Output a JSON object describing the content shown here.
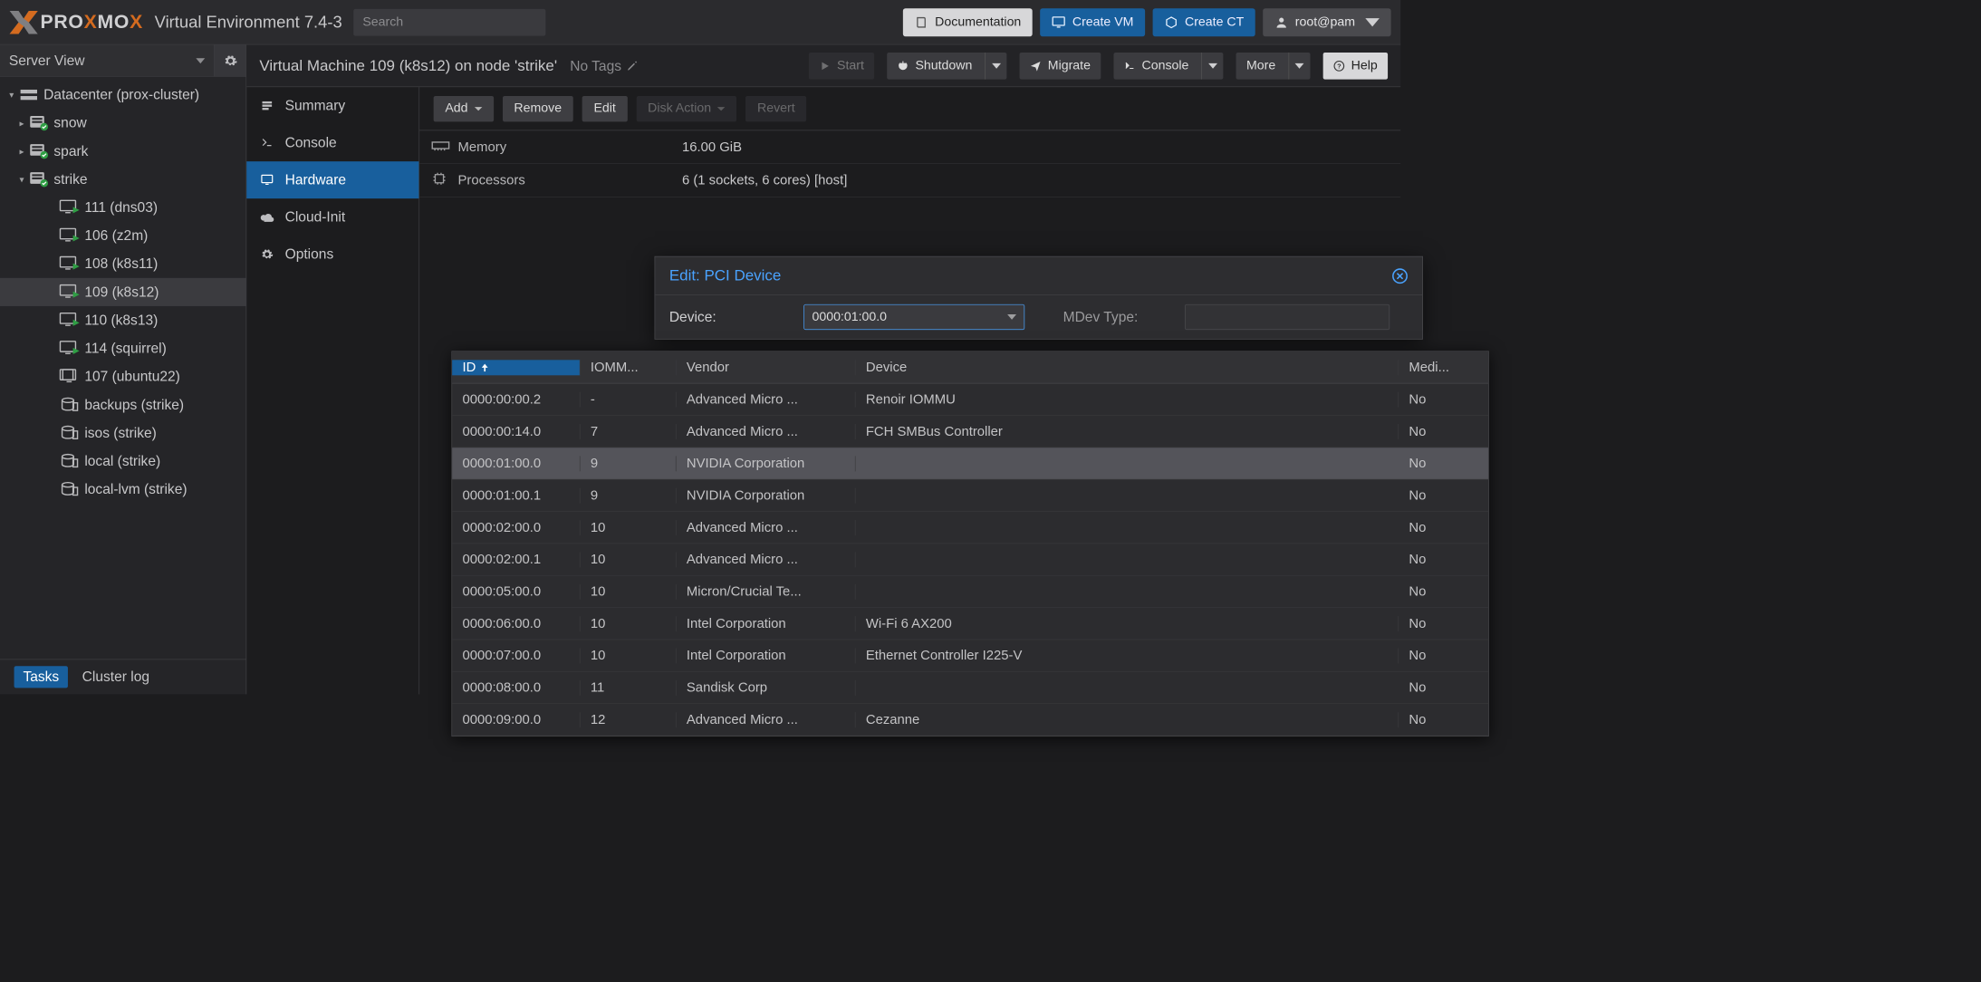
{
  "header": {
    "product": "PROXMOX",
    "env": "Virtual Environment 7.4-3",
    "search_placeholder": "Search",
    "doc": "Documentation",
    "create_vm": "Create VM",
    "create_ct": "Create CT",
    "user": "root@pam"
  },
  "view_selector": "Server View",
  "tree": {
    "dc": "Datacenter (prox-cluster)",
    "nodes": [
      "snow",
      "spark",
      "strike"
    ],
    "strike_items": [
      {
        "icon": "vm",
        "label": "111 (dns03)"
      },
      {
        "icon": "vm",
        "label": "106 (z2m)"
      },
      {
        "icon": "vm",
        "label": "108 (k8s11)"
      },
      {
        "icon": "vm",
        "label": "109 (k8s12)",
        "sel": true
      },
      {
        "icon": "vm",
        "label": "110 (k8s13)"
      },
      {
        "icon": "vm",
        "label": "114 (squirrel)"
      },
      {
        "icon": "ct",
        "label": "107 (ubuntu22)"
      },
      {
        "icon": "st",
        "label": "backups (strike)"
      },
      {
        "icon": "st",
        "label": "isos (strike)"
      },
      {
        "icon": "st",
        "label": "local (strike)"
      },
      {
        "icon": "st",
        "label": "local-lvm (strike)"
      }
    ]
  },
  "footer": {
    "tasks": "Tasks",
    "cluster": "Cluster log"
  },
  "vm": {
    "title": "Virtual Machine 109 (k8s12) on node 'strike'",
    "notags": "No Tags",
    "btn": {
      "start": "Start",
      "shutdown": "Shutdown",
      "migrate": "Migrate",
      "console": "Console",
      "more": "More",
      "help": "Help"
    }
  },
  "side": [
    "Summary",
    "Console",
    "Hardware",
    "Cloud-Init",
    "Options"
  ],
  "toolbar": {
    "add": "Add",
    "remove": "Remove",
    "edit": "Edit",
    "disk": "Disk Action",
    "revert": "Revert"
  },
  "hw": {
    "memory": {
      "name": "Memory",
      "value": "16.00 GiB"
    },
    "cpu": {
      "name": "Processors",
      "value": "6 (1 sockets, 6 cores) [host]"
    }
  },
  "modal": {
    "title": "Edit: PCI Device",
    "device_label": "Device:",
    "device_value": "0000:01:00.0",
    "mdev_label": "MDev Type:"
  },
  "grid": {
    "cols": {
      "id": "ID",
      "iommu": "IOMM...",
      "vendor": "Vendor",
      "device": "Device",
      "med": "Medi..."
    },
    "rows": [
      {
        "id": "0000:00:00.2",
        "iom": "-",
        "ven": "Advanced Micro ...",
        "dev": "Renoir IOMMU",
        "med": "No"
      },
      {
        "id": "0000:00:14.0",
        "iom": "7",
        "ven": "Advanced Micro ...",
        "dev": "FCH SMBus Controller",
        "med": "No"
      },
      {
        "id": "0000:01:00.0",
        "iom": "9",
        "ven": "NVIDIA Corporation",
        "dev": "",
        "med": "No",
        "sel": true
      },
      {
        "id": "0000:01:00.1",
        "iom": "9",
        "ven": "NVIDIA Corporation",
        "dev": "",
        "med": "No"
      },
      {
        "id": "0000:02:00.0",
        "iom": "10",
        "ven": "Advanced Micro ...",
        "dev": "",
        "med": "No"
      },
      {
        "id": "0000:02:00.1",
        "iom": "10",
        "ven": "Advanced Micro ...",
        "dev": "",
        "med": "No"
      },
      {
        "id": "0000:05:00.0",
        "iom": "10",
        "ven": "Micron/Crucial Te...",
        "dev": "",
        "med": "No"
      },
      {
        "id": "0000:06:00.0",
        "iom": "10",
        "ven": "Intel Corporation",
        "dev": "Wi-Fi 6 AX200",
        "med": "No"
      },
      {
        "id": "0000:07:00.0",
        "iom": "10",
        "ven": "Intel Corporation",
        "dev": "Ethernet Controller I225-V",
        "med": "No"
      },
      {
        "id": "0000:08:00.0",
        "iom": "11",
        "ven": "Sandisk Corp",
        "dev": "",
        "med": "No"
      },
      {
        "id": "0000:09:00.0",
        "iom": "12",
        "ven": "Advanced Micro ...",
        "dev": "Cezanne",
        "med": "No"
      }
    ]
  }
}
